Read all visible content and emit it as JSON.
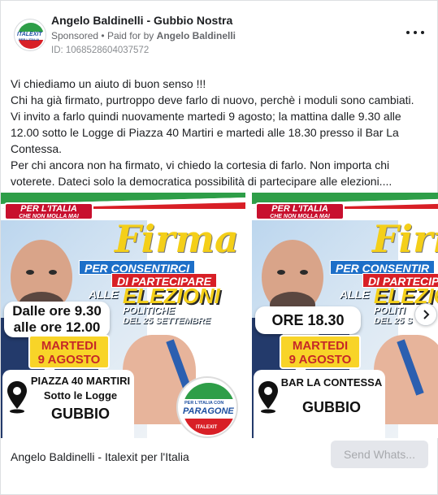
{
  "header": {
    "page_name": "Angelo Baldinelli - Gubbio Nostra",
    "sponsored_label": "Sponsored",
    "paid_for_prefix": "Paid for by",
    "paid_for_name": "Angelo Baldinelli",
    "ad_id": "ID: 1068528604037572",
    "avatar_logo_text": "ITALEXIT",
    "avatar_logo_subtext": "PER L'ITALIA",
    "more_icon": "more-horizontal-icon"
  },
  "body": {
    "lines": [
      "Vi chiediamo un aiuto di buon senso !!!",
      "Chi ha già firmato, purtroppo deve farlo di nuovo, perchè i moduli sono cambiati.",
      "Vi invito a farlo quindi nuovamente martedi 9 agosto; la mattina dalle 9.30 alle",
      "12.00 sotto le Logge di Piazza 40 Martiri e martedi alle 18.30 presso il Bar La",
      "Contessa.",
      "Per chi ancora non ha firmato, vi chiedo la cortesia di farlo. Non importa chi",
      "voterete. Dateci solo la democratica possibilità di partecipare alle elezioni...."
    ]
  },
  "carousel": {
    "slides": [
      {
        "banner_line1": "PER L'ITALIA",
        "banner_line2": "CHE NON MOLLA MAI",
        "headline": "Firma",
        "ribbon1": "PER CONSENTIRCI",
        "ribbon2": "DI PARTECIPARE",
        "alle": "ALLE",
        "elezioni": "ELEZIONI",
        "politiche": "POLITICHE",
        "settembre": "DEL 25 SETTEMBRE",
        "time_line1": "Dalle ore 9.30",
        "time_line2": "alle ore 12.00",
        "day": "MARTEDI",
        "date": "9 AGOSTO",
        "loc_line1": "PIAZZA 40 MARTIRI",
        "loc_line2": "Sotto le Logge",
        "city": "GUBBIO",
        "logo_top": "PER L'ITALIA CON",
        "logo_name": "PARAGONE",
        "logo_bottom": "ITALEXIT"
      },
      {
        "banner_line1": "PER L'ITALIA",
        "banner_line2": "CHE NON MOLLA MAI",
        "headline": "Firm",
        "ribbon1": "PER CONSENTIR",
        "ribbon2": "DI PARTECIP",
        "alle": "ALLE",
        "elezioni": "ELEZIO",
        "politiche": "POLITI",
        "settembre": "DEL 25 S",
        "time_line1": "ORE 18.30",
        "day": "MARTEDI",
        "date": "9 AGOSTO",
        "loc_line1": "BAR LA CONTESSA",
        "city": "GUBBIO"
      }
    ],
    "next_icon": "chevron-right-icon"
  },
  "footer": {
    "title": "Angelo Baldinelli - Italexit per l'Italia",
    "cta_label": "Send Whats..."
  },
  "colors": {
    "brand_red": "#c8102e",
    "brand_green": "#2e9e48",
    "brand_blue": "#1d6fc8",
    "headline_yellow": "#f4cf19",
    "meta_gray": "#65676b"
  }
}
